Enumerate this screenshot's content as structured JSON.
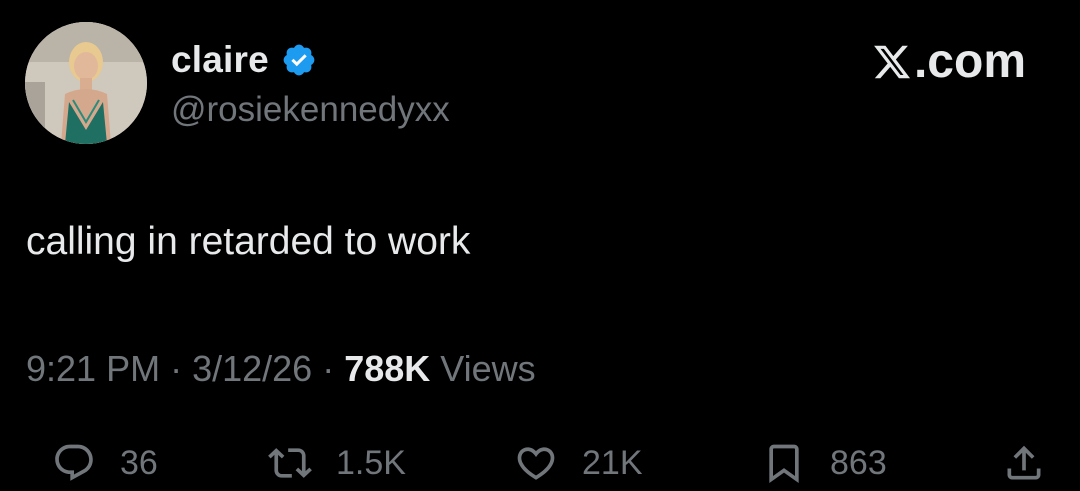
{
  "author": {
    "display_name": "claire",
    "handle": "@rosiekennedyxx",
    "verified": true,
    "verified_color": "#1d9bf0"
  },
  "brand": {
    "text": ".com",
    "icon": "x-logo-icon"
  },
  "tweet": {
    "text": "calling in retarded to work"
  },
  "meta": {
    "time": "9:21 PM",
    "separator": "·",
    "date": "3/12/26",
    "views_count": "788K",
    "views_label": "Views"
  },
  "actions": {
    "replies": "36",
    "reposts": "1.5K",
    "likes": "21K",
    "bookmarks": "863"
  },
  "colors": {
    "background": "#000000",
    "primary_text": "#e7e9ea",
    "secondary_text": "#71767b"
  }
}
